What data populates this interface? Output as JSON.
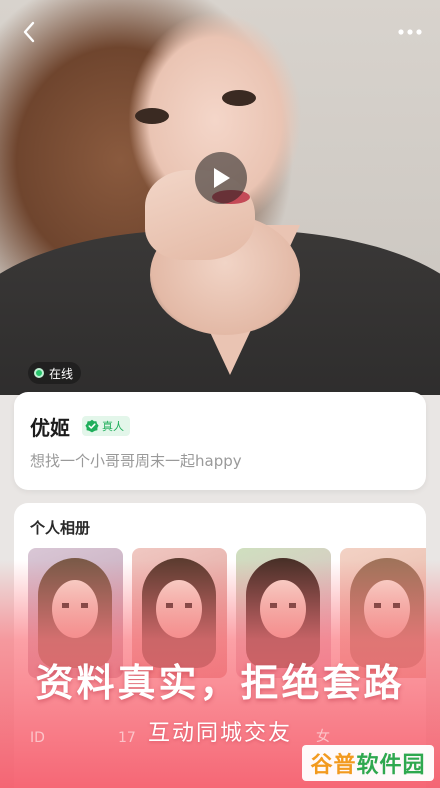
{
  "profile": {
    "online_label": "在线",
    "name": "优姬",
    "verified_label": "真人",
    "bio": "想找一个小哥哥周末一起happy"
  },
  "album": {
    "title": "个人相册"
  },
  "details": {
    "id_label": "ID",
    "id_value": "17",
    "gender": "女"
  },
  "promo": {
    "slogan": "资料真实，拒绝套路",
    "subslogan": "互动同城交友"
  },
  "watermark": {
    "part1": "谷普",
    "part2": "软件园"
  },
  "colors": {
    "online": "#27c46b",
    "verified": "#1fae5b",
    "overlay": "#f55f6e"
  },
  "icons": [
    "back-arrow-icon",
    "more-dots-icon",
    "play-icon",
    "verified-check-icon"
  ]
}
